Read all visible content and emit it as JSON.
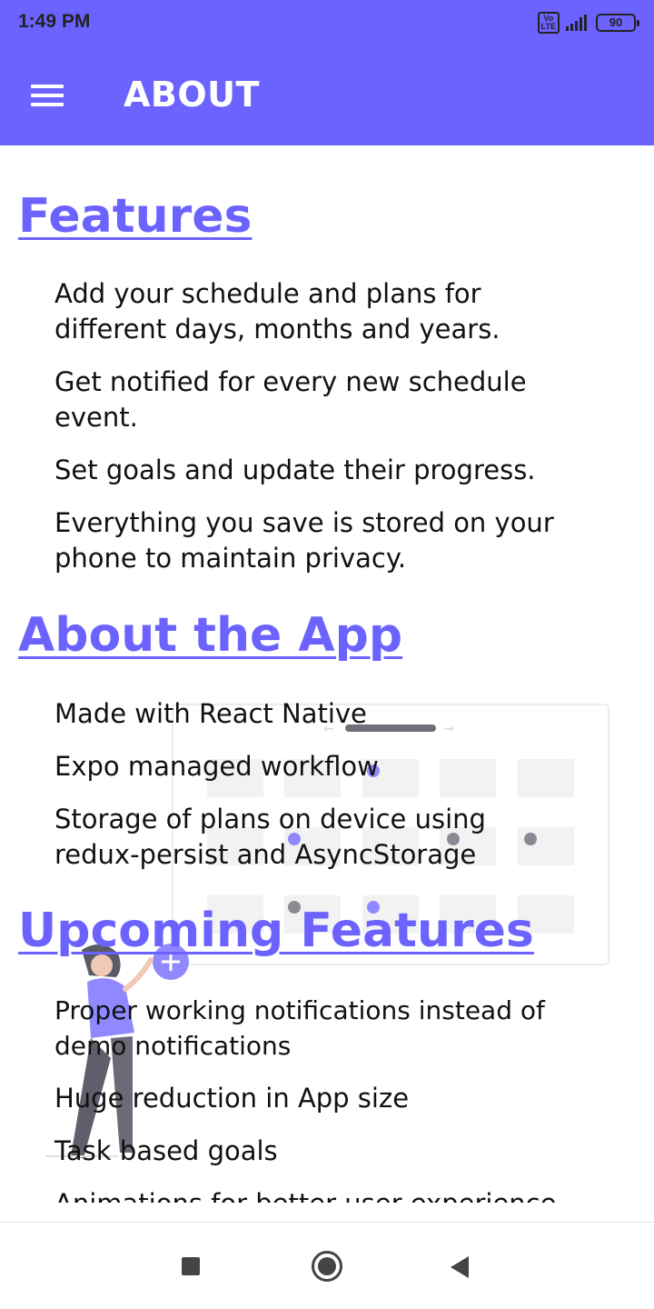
{
  "status_bar": {
    "time": "1:49 PM",
    "network_badge": "Vo LTE",
    "signal_icon": "signal-bars-icon",
    "battery": "90"
  },
  "app_bar": {
    "menu_icon": "hamburger-menu-icon",
    "title": "ABOUT"
  },
  "sections": [
    {
      "heading": "Features",
      "items": [
        "Add your schedule and plans for\ndifferent days, months and years.",
        "Get notified for every new schedule\nevent.",
        "Set goals and update their progress.",
        "Everything you save is stored on your\nphone to maintain privacy."
      ]
    },
    {
      "heading": "About the App",
      "items": [
        "Made with React Native",
        "Expo managed workflow",
        "Storage of plans on device using\nredux-persist and AsyncStorage"
      ]
    },
    {
      "heading": "Upcoming Features",
      "items": [
        "Proper working notifications instead of\ndemo notifications",
        "Huge reduction in App size",
        "Task based goals",
        "Animations for better user experience"
      ]
    }
  ],
  "colors": {
    "accent": "#6c63ff",
    "text": "#111111",
    "background": "#ffffff"
  },
  "nav_bar": {
    "recents_icon": "square-recents-icon",
    "home_icon": "circle-home-icon",
    "back_icon": "triangle-back-icon"
  }
}
